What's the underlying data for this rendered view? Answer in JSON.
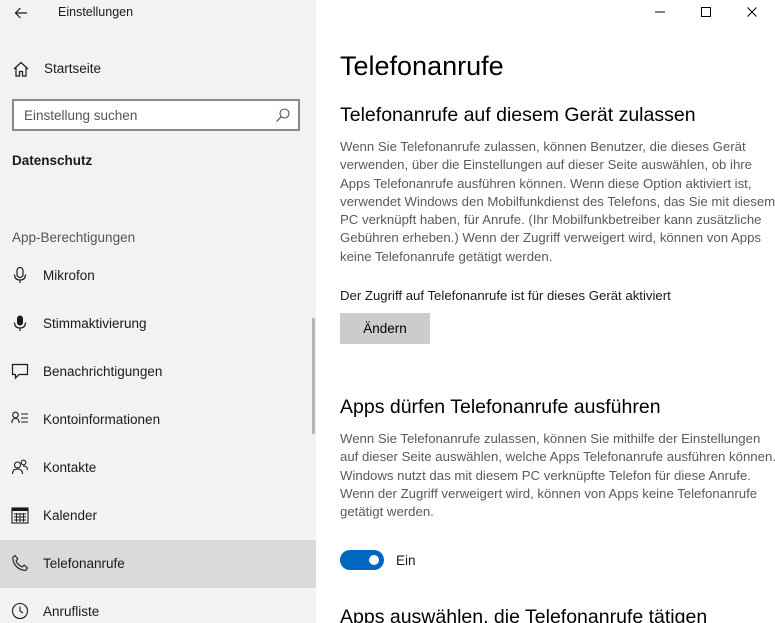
{
  "window": {
    "title": "Einstellungen",
    "minimize_glyph": "—",
    "maximize_glyph": "☐",
    "close_glyph": "✕"
  },
  "sidebar": {
    "home_label": "Startseite",
    "search_placeholder": "Einstellung suchen",
    "section_title": "Datenschutz",
    "group_label": "App-Berechtigungen",
    "items": [
      {
        "label": "Mikrofon",
        "icon": "microphone-icon"
      },
      {
        "label": "Stimmaktivierung",
        "icon": "voice-activation-icon"
      },
      {
        "label": "Benachrichtigungen",
        "icon": "notification-icon"
      },
      {
        "label": "Kontoinformationen",
        "icon": "account-info-icon"
      },
      {
        "label": "Kontakte",
        "icon": "contacts-icon"
      },
      {
        "label": "Kalender",
        "icon": "calendar-icon"
      },
      {
        "label": "Telefonanrufe",
        "icon": "phone-icon",
        "selected": true
      },
      {
        "label": "Anrufliste",
        "icon": "call-history-icon"
      }
    ]
  },
  "main": {
    "page_title": "Telefonanrufe",
    "section1": {
      "heading": "Telefonanrufe auf diesem Gerät zulassen",
      "description": "Wenn Sie Telefonanrufe zulassen, können Benutzer, die dieses Gerät verwenden, über die Einstellungen auf dieser Seite auswählen, ob ihre Apps Telefonanrufe ausführen können. Wenn diese Option aktiviert ist, verwendet Windows den Mobilfunkdienst des Telefons, das Sie mit diesem PC verknüpft haben, für Anrufe. (Ihr Mobilfunkbetreiber kann zusätzliche Gebühren erheben.) Wenn der Zugriff verweigert wird, können von Apps keine Telefonanrufe getätigt werden.",
      "status": "Der Zugriff auf Telefonanrufe ist für dieses Gerät aktiviert",
      "change_button": "Ändern"
    },
    "section2": {
      "heading": "Apps dürfen Telefonanrufe ausführen",
      "description": "Wenn Sie Telefonanrufe zulassen, können Sie mithilfe der Einstellungen auf dieser Seite auswählen, welche Apps Telefonanrufe ausführen können. Windows nutzt das mit diesem PC verknüpfte Telefon für diese Anrufe. Wenn der Zugriff verweigert wird, können von Apps keine Telefonanrufe getätigt werden.",
      "toggle_state": "Ein",
      "toggle_on": true
    },
    "section3": {
      "heading": "Apps auswählen, die Telefonanrufe tätigen"
    }
  },
  "colors": {
    "sidebar_bg": "#f2f2f2",
    "selected_bg": "#dadada",
    "accent": "#0067c0",
    "button_bg": "#cccccc"
  }
}
